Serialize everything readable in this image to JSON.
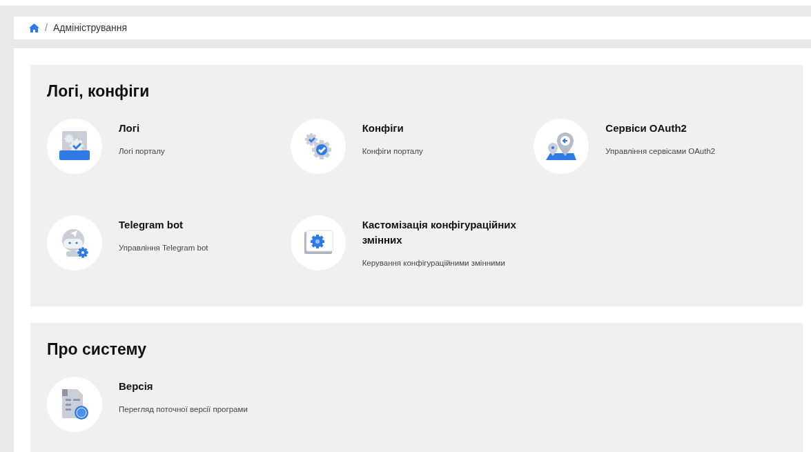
{
  "breadcrumb": {
    "items": [
      {
        "kind": "home"
      },
      {
        "kind": "text",
        "label": "Адміністрування"
      }
    ],
    "separator": "/"
  },
  "sections": [
    {
      "title": "Логі, конфіги",
      "items": [
        {
          "kind": "logs",
          "title": "Логі",
          "description": "Логі порталу"
        },
        {
          "kind": "configs",
          "title": "Конфіги",
          "description": "Конфіги порталу"
        },
        {
          "kind": "oauth",
          "title": "Сервіси OAuth2",
          "description": "Управління сервісами OAuth2"
        },
        {
          "kind": "bot",
          "title": "Telegram bot",
          "description": "Управління Telegram bot"
        },
        {
          "kind": "variables",
          "title": "Кастомізація конфігураційних змінних",
          "description": "Керування конфігураційними змінними"
        }
      ]
    },
    {
      "title": "Про систему",
      "items": [
        {
          "kind": "version",
          "title": "Версія",
          "description": "Перегляд поточної версії програми"
        }
      ]
    }
  ]
}
